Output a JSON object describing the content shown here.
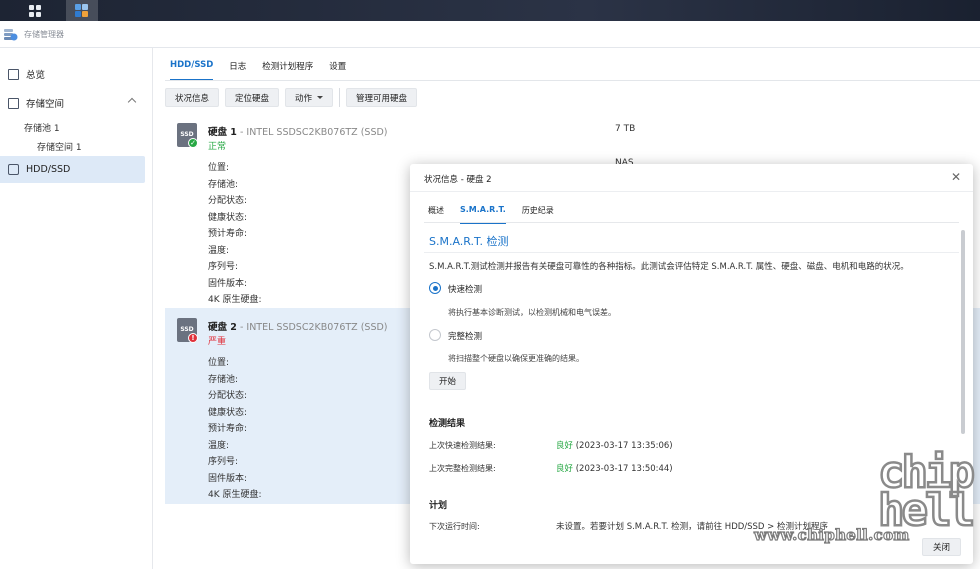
{
  "app": {
    "title": "存储管理器"
  },
  "sidebar": {
    "items": [
      {
        "label": "总览"
      },
      {
        "label": "存储空间"
      },
      {
        "label": "HDD/SSD"
      }
    ],
    "pool": "存储池 1",
    "volume": "存储空间 1"
  },
  "main": {
    "tabs": [
      "HDD/SSD",
      "日志",
      "检测计划程序",
      "设置"
    ],
    "toolbar": {
      "health": "状况信息",
      "locate": "定位硬盘",
      "action": "动作",
      "manage": "管理可用硬盘"
    },
    "field_labels": [
      "位置:",
      "存储池:",
      "分配状态:",
      "健康状态:",
      "预计寿命:",
      "温度:",
      "序列号:",
      "固件版本:",
      "4K 原生硬盘:"
    ],
    "disks": [
      {
        "icon": "SSD",
        "name": "硬盘 1",
        "model": " - INTEL SSDSC2KB076TZ (SSD)",
        "status": "正常",
        "size": "7 TB",
        "location": "NAS"
      },
      {
        "icon": "SSD",
        "name": "硬盘 2",
        "model": " - INTEL SSDSC2KB076TZ (SSD)",
        "status": "严重"
      }
    ]
  },
  "modal": {
    "title": "状况信息 - 硬盘 2",
    "tabs": [
      "概述",
      "S.M.A.R.T.",
      "历史纪录"
    ],
    "section_title": "S.M.A.R.T. 检测",
    "description": "S.M.A.R.T.测试检测并报告有关硬盘可靠性的各种指标。此测试会评估特定 S.M.A.R.T. 属性、硬盘、磁盘、电机和电路的状况。",
    "quick_label": "快速检测",
    "quick_desc": "将执行基本诊断测试，以检测机械和电气误差。",
    "full_label": "完整检测",
    "full_desc": "将扫描整个硬盘以确保更准确的结果。",
    "start": "开始",
    "results_title": "检测结果",
    "last_quick_label": "上次快速检测结果:",
    "last_quick_status": "良好",
    "last_quick_time": " (2023-03-17 13:35:06)",
    "last_full_label": "上次完整检测结果:",
    "last_full_status": "良好",
    "last_full_time": " (2023-03-17 13:50:44)",
    "schedule_title": "计划",
    "next_run_label": "下次运行时间:",
    "next_run_value": "未设置。若要计划 S.M.A.R.T. 检测，请前往 HDD/SSD > 检测计划程序",
    "close": "关闭"
  },
  "watermark": {
    "site": "www.chiphell.com",
    "logo": "chip\nhell"
  },
  "colors": {
    "accent": "#1a73c9",
    "ok": "#27a844",
    "critical": "#e0303a",
    "selected": "#e4eef9"
  }
}
